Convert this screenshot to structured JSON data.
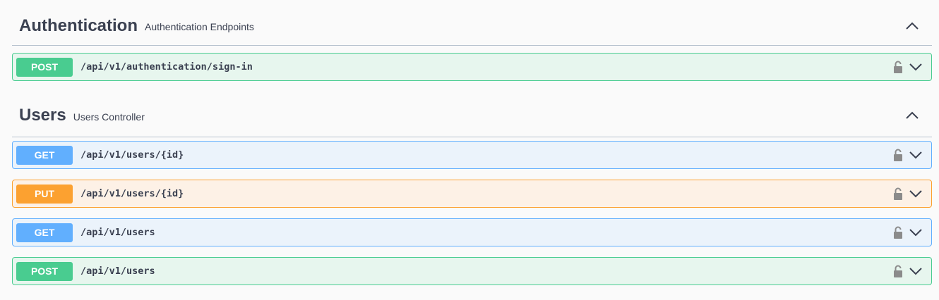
{
  "sections": [
    {
      "title": "Authentication",
      "description": "Authentication Endpoints",
      "operations": [
        {
          "method": "POST",
          "path": "/api/v1/authentication/sign-in"
        }
      ]
    },
    {
      "title": "Users",
      "description": "Users Controller",
      "operations": [
        {
          "method": "GET",
          "path": "/api/v1/users/{id}"
        },
        {
          "method": "PUT",
          "path": "/api/v1/users/{id}"
        },
        {
          "method": "GET",
          "path": "/api/v1/users"
        },
        {
          "method": "POST",
          "path": "/api/v1/users"
        }
      ]
    }
  ],
  "colors": {
    "post": "#49cc90",
    "get": "#61affe",
    "put": "#fca130",
    "text": "#3b4151"
  },
  "icons": {
    "collapse": "chevron-up-icon",
    "lock": "lock-icon",
    "expand": "chevron-down-icon"
  }
}
